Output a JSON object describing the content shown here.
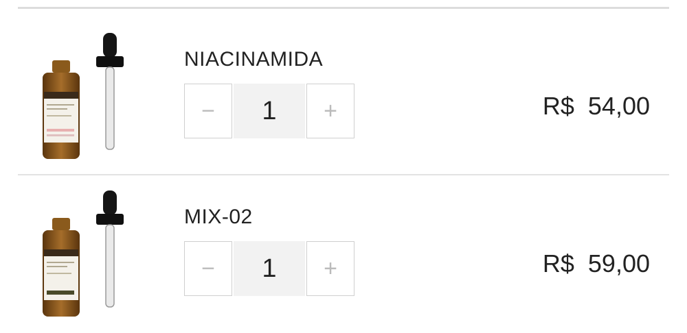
{
  "cart": {
    "items": [
      {
        "name": "NIACINAMIDA",
        "quantity": "1",
        "minus_label": "−",
        "plus_label": "+",
        "price": "R$  54,00",
        "image": "serum-dropper-bottle-image"
      },
      {
        "name": "MIX-02",
        "quantity": "1",
        "minus_label": "−",
        "plus_label": "+",
        "price": "R$  59,00",
        "image": "serum-dropper-bottle-image"
      }
    ]
  }
}
